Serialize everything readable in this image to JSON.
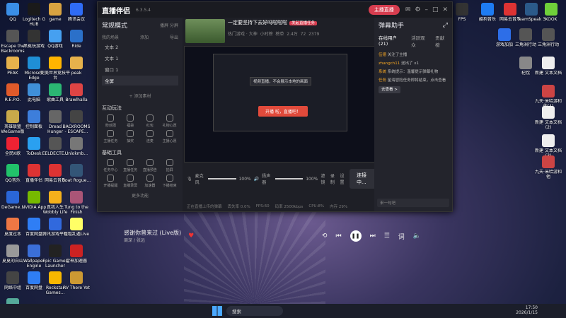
{
  "desktop": {
    "icons": [
      {
        "label": "QQ",
        "color": "#3a8ee6"
      },
      {
        "label": "Logitech G HUB",
        "color": "#1a1a1a"
      },
      {
        "label": "game",
        "color": "#d9a441"
      },
      {
        "label": "腾讯会议",
        "color": "#2f6cf6"
      },
      {
        "label": "Escape the Backrooms",
        "color": "#555"
      },
      {
        "label": "黑冕玩游戏",
        "color": "#333"
      },
      {
        "label": "QQ游戏",
        "color": "#46a0f0"
      },
      {
        "label": "Ride",
        "color": "#2b70c9"
      },
      {
        "label": "PEAK",
        "color": "#e6b24c"
      },
      {
        "label": "Microsoft Edge",
        "color": "#1f8fd6"
      },
      {
        "label": "完美世界竞技平台",
        "color": "#ffb400"
      },
      {
        "label": "peak",
        "color": "#e6b24c"
      },
      {
        "label": "R.E.P.O.",
        "color": "#e05a2a"
      },
      {
        "label": "此电脑",
        "color": "#3f8fd8"
      },
      {
        "label": "歌曲工具",
        "color": "#2bb673"
      },
      {
        "label": "Brawlhalla",
        "color": "#d44"
      },
      {
        "label": "英雄联盟WeGame版",
        "color": "#c8a94a"
      },
      {
        "label": "控制面板",
        "color": "#3d7edb"
      },
      {
        "label": "Dread Hunger",
        "color": "#666"
      },
      {
        "label": "BACKROOMS - ESCAPE...",
        "color": "#444"
      },
      {
        "label": "全民K歌",
        "color": "#e23"
      },
      {
        "label": "ToDesk",
        "color": "#2aa0f0"
      },
      {
        "label": "EELDECTE...",
        "color": "#555"
      },
      {
        "label": "Unlokmb...",
        "color": "#777"
      },
      {
        "label": "QQ音乐",
        "color": "#21c26a"
      },
      {
        "label": "直播伴侣",
        "color": "#d33"
      },
      {
        "label": "网易云音乐",
        "color": "#d33"
      },
      {
        "label": "Boat Rogue...",
        "color": "#357"
      },
      {
        "label": "DeGame...",
        "color": "#2a66d8"
      },
      {
        "label": "NVIDIA App",
        "color": "#76b900"
      },
      {
        "label": "真我人生 Wobbly Life",
        "color": "#f5b01b"
      },
      {
        "label": "Tung to the Finish",
        "color": "#a57"
      },
      {
        "label": "夏度过本",
        "color": "#e74"
      },
      {
        "label": "百度网盘",
        "color": "#2f7ef5"
      },
      {
        "label": "腾讯游戏平台",
        "color": "#3169dd"
      },
      {
        "label": "粗粗乱遁Live",
        "color": "#ff6"
      },
      {
        "label": "夏夏的白山",
        "color": "#999"
      },
      {
        "label": "Wallpaper Engine",
        "color": "#3b6fd8"
      },
      {
        "label": "Epic Games Launcher",
        "color": "#222"
      },
      {
        "label": "雷神加速器",
        "color": "#c22"
      },
      {
        "label": "网络中组",
        "color": "#444"
      },
      {
        "label": "百度网盘",
        "color": "#2f7ef5"
      },
      {
        "label": "Rockstar Games...",
        "color": "#f8b700"
      },
      {
        "label": "RV There Yet",
        "color": "#c93"
      },
      {
        "label": "Only Up BRAINR...",
        "color": "#5a9"
      }
    ],
    "right_icons": [
      {
        "label": "FPS",
        "color": "#333"
      },
      {
        "label": "酷狗音乐",
        "color": "#1e7cf2"
      },
      {
        "label": "网易云音乐",
        "color": "#d33"
      },
      {
        "label": "TeamSpeak 3",
        "color": "#2b5a8a"
      },
      {
        "label": "KOOK",
        "color": "#6fd03a"
      },
      {
        "label": "游戏加加",
        "color": "#2d6ee8"
      },
      {
        "label": "三角洲行动",
        "color": "#555"
      },
      {
        "label": "三角洲行动",
        "color": "#555"
      },
      {
        "label": "杞忱",
        "color": "#888"
      },
      {
        "label": "新建 文本文档",
        "color": "#eee"
      },
      {
        "label": "九天·米哈游和他(4)",
        "color": "#c44"
      },
      {
        "label": "新建 文本文档 (2)",
        "color": "#eee"
      },
      {
        "label": "新建 文本文档 (3)",
        "color": "#eee"
      },
      {
        "label": "九天·米哈游和他",
        "color": "#c44"
      }
    ]
  },
  "app": {
    "name": "直播伴侣",
    "version": "6.3.5.4",
    "start_live": "主播直播",
    "scenes_header": "常规模式",
    "scenes_actions": [
      "播屏",
      "分屏"
    ],
    "scene_tabs": [
      "我的场景",
      "添加",
      "导出"
    ],
    "scenes": [
      "文本 2",
      "文本 1",
      "窗口 1",
      "全屏"
    ],
    "add_material": "+ 添加素材",
    "interact_title": "互动玩法",
    "interact": [
      "粉丝团",
      "福袋",
      "红包",
      "礼物心愿",
      "主播任务",
      "抽奖",
      "连麦",
      "主播心愿"
    ],
    "tools_title": "基础工具",
    "tools": [
      "任务中心",
      "直播任务",
      "直播预告",
      "拍屏",
      "开播提醒",
      "直播录屏",
      "加速器",
      "下播结束"
    ],
    "more": "更多功能",
    "room_title": "一定要坚持下去好吗啦啦啦",
    "room_tag": "发起直播任务",
    "room_sub": "热门游戏 · 大神",
    "room_stats": [
      "小时榜",
      "榜单",
      "2.4万",
      "72",
      "2379"
    ],
    "preview_btn": "开播 啦，直播吧！",
    "tooltip": "视频直播，不会展示本地的画面",
    "mixer": {
      "mic": "麦克风",
      "vol1": "100%",
      "speaker": "扬声器",
      "vol2": "100%",
      "extras": [
        "滤镜",
        "录制",
        "设置"
      ],
      "connect": "连接中..."
    },
    "status": [
      "正在直播上传的弹幕",
      "丢失率 0.0%",
      "FPS:60",
      "码率 2500kbps",
      "CPU:8%",
      "内存 29%"
    ],
    "right": {
      "head": "弹幕助手",
      "tabs": [
        "在线用户(21)",
        "活跃观众",
        "贡献榜"
      ],
      "msgs": [
        {
          "user": "伍德",
          "text": "关注了主播"
        },
        {
          "user": "zhangch11",
          "text": "送出了 x1"
        },
        {
          "user": "系统",
          "text": "系统提示：温馨提示弹幕礼物"
        },
        {
          "user": "任务",
          "text": "星海冒险任务即将结束，点击查看"
        }
      ],
      "task_btn": "去查看 >",
      "input_placeholder": "来一句吧"
    }
  },
  "player": {
    "song": "感谢你曾来过 (Live版)",
    "artist": "周深 / 张远"
  },
  "taskbar": {
    "search": "搜索",
    "time": "17:50",
    "date": "2026/1/15"
  }
}
